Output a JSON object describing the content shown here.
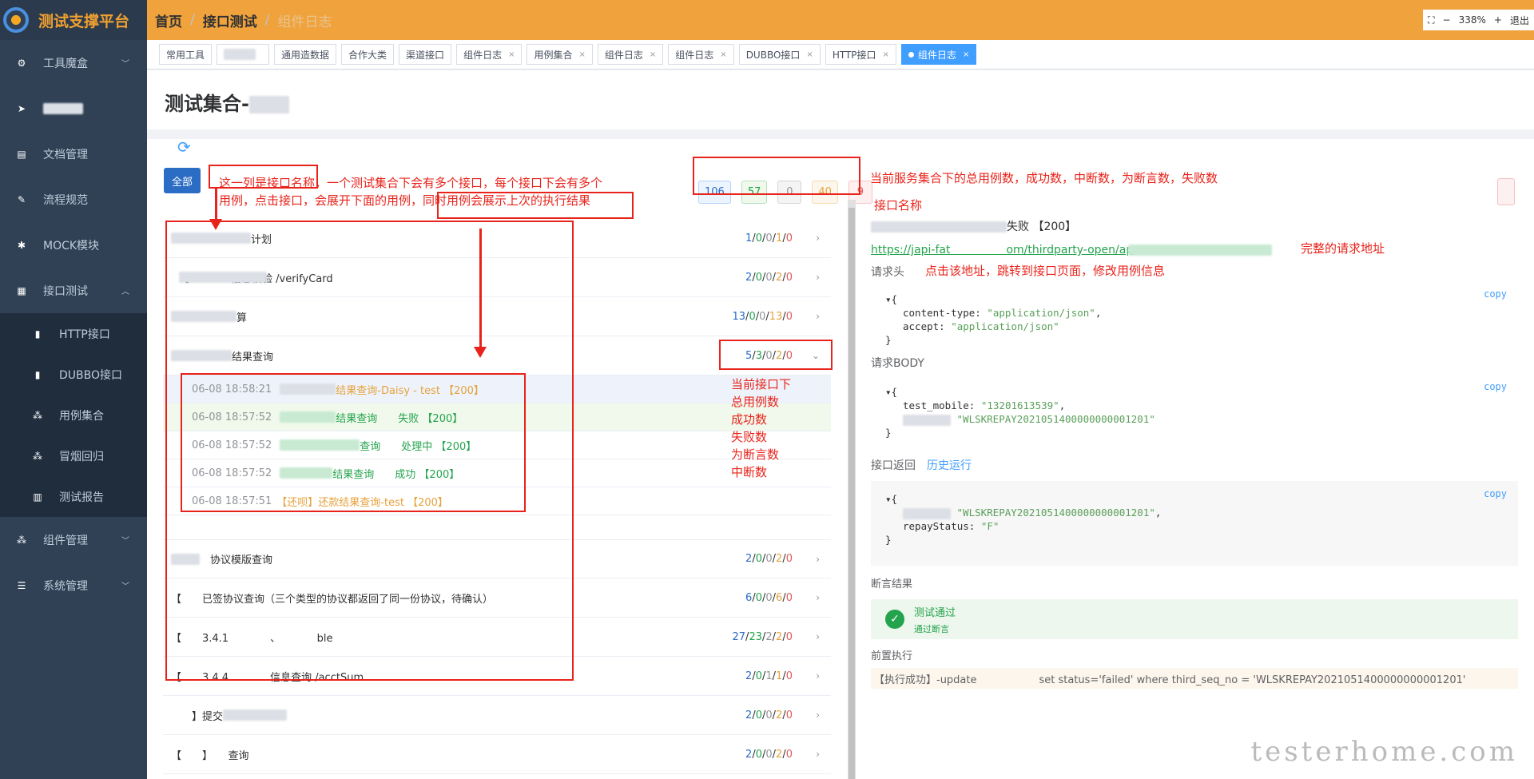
{
  "app": {
    "title": "测试支撑平台"
  },
  "breadcrumb": [
    "首页",
    "接口测试",
    "组件日志"
  ],
  "zoom": {
    "level": "338%",
    "minus": "−",
    "plus": "+",
    "exit": "退出"
  },
  "sidebar": {
    "items": [
      {
        "label": "工具魔盒",
        "icon": "tool-icon"
      },
      {
        "label": "",
        "icon": "send-icon"
      },
      {
        "label": "文档管理",
        "icon": "document-icon"
      },
      {
        "label": "流程规范",
        "icon": "edit-icon"
      },
      {
        "label": "MOCK模块",
        "icon": "bug-icon"
      },
      {
        "label": "接口测试",
        "icon": "grid-icon"
      },
      {
        "label": "组件管理",
        "icon": "component-icon"
      },
      {
        "label": "系统管理",
        "icon": "list-icon"
      }
    ],
    "subitems": [
      {
        "label": "HTTP接口"
      },
      {
        "label": "DUBBO接口"
      },
      {
        "label": "用例集合"
      },
      {
        "label": "冒烟回归"
      },
      {
        "label": "测试报告"
      }
    ]
  },
  "tabs": [
    "常用工具",
    "",
    "通用造数据",
    "合作大类",
    "渠道接口",
    "组件日志",
    "用例集合",
    "组件日志",
    "组件日志",
    "DUBBO接口",
    "HTTP接口",
    "组件日志"
  ],
  "page": {
    "title": "测试集合-",
    "all_button": "全部",
    "refresh_icon": "refresh-icon"
  },
  "stats": {
    "total": "106",
    "success": "57",
    "interrupt": "0",
    "assert": "40",
    "fail": "9"
  },
  "annotations": {
    "name_col": "这一列是接口名称，一个测试集合下会有多个接口，每个接口下会有多个",
    "name_col2": "用例，点击接口，会展开下面的用例，同时用例会展示上次的执行结果",
    "stats_desc": "当前服务集合下的总用例数，成功数，中断数，为断言数，失败数",
    "current": [
      "当前接口下",
      "总用例数",
      "成功数",
      "失败数",
      "为断言数",
      "中断数"
    ],
    "iface_name": "接口名称",
    "url_desc": "完整的请求地址",
    "url_click": "点击该地址，跳转到接口页面，修改用例信息"
  },
  "rows": [
    {
      "name": "计划",
      "counts": [
        "1",
        "0",
        "0",
        "1",
        "0"
      ]
    },
    {
      "name": "【　　　　信息校验 /verifyCard",
      "counts": [
        "2",
        "0",
        "0",
        "2",
        "0"
      ]
    },
    {
      "name": "算",
      "counts": [
        "13",
        "0",
        "0",
        "13",
        "0"
      ]
    },
    {
      "name": "结果查询",
      "counts": [
        "5",
        "3",
        "0",
        "2",
        "0"
      ]
    }
  ],
  "cases": [
    {
      "time": "06-08 18:58:21",
      "text": "结果查询-Daisy - test 【200】",
      "color": "#e6a23c"
    },
    {
      "time": "06-08 18:57:52",
      "text": "结果查询　　失败 【200】",
      "color": "#23a34c"
    },
    {
      "time": "06-08 18:57:52",
      "text": "查询　　处理中 【200】",
      "color": "#23a34c"
    },
    {
      "time": "06-08 18:57:52",
      "text": "结果查询　　成功 【200】",
      "color": "#23a34c"
    },
    {
      "time": "06-08 18:57:51",
      "text": "【还呗】还款结果查询-test 【200】",
      "color": "#e6a23c"
    }
  ],
  "rows2": [
    {
      "name": "　协议模版查询",
      "counts": [
        "2",
        "0",
        "0",
        "2",
        "0"
      ]
    },
    {
      "name": "【　　已签协议查询（三个类型的协议都返回了同一份协议，待确认）",
      "counts": [
        "6",
        "0",
        "0",
        "6",
        "0"
      ]
    },
    {
      "name": "【　　3.4.1　　　　、　　　　ble",
      "counts": [
        "27",
        "23",
        "2",
        "2",
        "0"
      ]
    },
    {
      "name": "【　　3.4.4　　　　信息查询 /acctSum",
      "counts": [
        "2",
        "0",
        "1",
        "1",
        "0"
      ]
    },
    {
      "name": "　　】提交",
      "counts": [
        "2",
        "0",
        "0",
        "2",
        "0"
      ]
    },
    {
      "name": "【　　】　　查询",
      "counts": [
        "2",
        "0",
        "0",
        "2",
        "0"
      ]
    }
  ],
  "detail": {
    "title": "失败 【200】",
    "url": "https://japi-fat　　　　　om/thirdparty-open/ap",
    "req_header_label": "请求头",
    "headers": {
      "content_type": "\"application/json\"",
      "accept": "\"application/json\""
    },
    "req_body_label": "请求BODY",
    "body": {
      "test_mobile": "\"13201613539\"",
      "seq": "\"WLSKREPAY2021051400000000001201\""
    },
    "resp_label": "接口返回",
    "history_label": "历史运行",
    "resp": {
      "seq": "\"WLSKREPAY2021051400000000001201\"",
      "repayStatus": "\"F\""
    },
    "copy": "copy",
    "assert_label": "断言结果",
    "assert_title": "测试通过",
    "assert_sub": "通过断言",
    "pre_label": "前置执行",
    "pre_text": "【执行成功】-update　　　　　　set status='failed' where third_seq_no = 'WLSKREPAY2021051400000000001201'"
  },
  "watermark": "testerhome.com"
}
